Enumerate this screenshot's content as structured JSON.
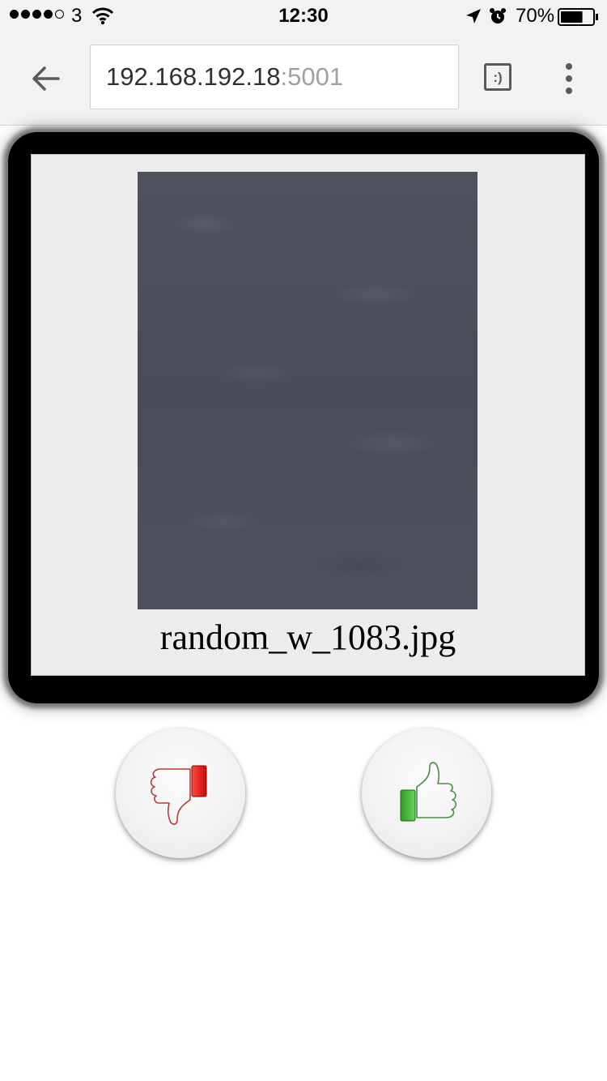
{
  "status_bar": {
    "carrier": "3",
    "time": "12:30",
    "battery_percent": "70%",
    "signal_bars_filled": 4,
    "signal_bars_total": 5,
    "battery_level": 0.7
  },
  "browser": {
    "url_host": "192.168.192.18",
    "url_port": ":5001",
    "tab_icon_text": ":)"
  },
  "card": {
    "file_name": "random_w_1083.jpg"
  },
  "colors": {
    "dislike": "#e0201b",
    "like": "#2e9a28"
  },
  "icons": {
    "back": "arrow-left-icon",
    "tabs": "tab-switcher-icon",
    "menu": "more-vertical-icon",
    "dislike": "thumbs-down-icon",
    "like": "thumbs-up-icon"
  }
}
